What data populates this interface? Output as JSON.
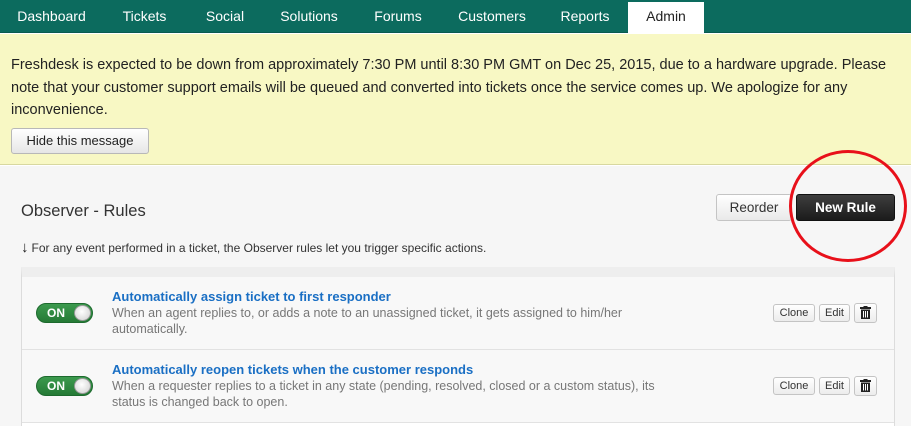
{
  "nav": {
    "tabs": [
      {
        "label": "Dashboard",
        "active": false
      },
      {
        "label": "Tickets",
        "active": false
      },
      {
        "label": "Social",
        "active": false
      },
      {
        "label": "Solutions",
        "active": false
      },
      {
        "label": "Forums",
        "active": false
      },
      {
        "label": "Customers",
        "active": false
      },
      {
        "label": "Reports",
        "active": false
      },
      {
        "label": "Admin",
        "active": true
      }
    ]
  },
  "banner": {
    "message": "Freshdesk is expected to be down from approximately 7:30 PM until 8:30 PM GMT on Dec 25, 2015, due to a hardware upgrade. Please note that your customer support emails will be queued and converted into tickets once the service comes up. We apologize for any inconvenience.",
    "hide_label": "Hide this message"
  },
  "page": {
    "title": "Observer - Rules",
    "reorder_label": "Reorder",
    "new_rule_label": "New Rule",
    "info_text": "For any event performed in a ticket, the Observer rules let you trigger specific actions."
  },
  "rules": [
    {
      "toggle": "ON",
      "title": "Automatically assign ticket to first responder",
      "description": "When an agent replies to, or adds a note to an unassigned ticket, it gets assigned to him/her automatically.",
      "clone_label": "Clone",
      "edit_label": "Edit"
    },
    {
      "toggle": "ON",
      "title": "Automatically reopen tickets when the customer responds",
      "description": "When a requester replies to a ticket in any state (pending, resolved, closed or a custom status), its status is changed back to open.",
      "clone_label": "Clone",
      "edit_label": "Edit"
    }
  ],
  "colors": {
    "nav_bg": "#0c6b5e",
    "banner_bg": "#f8f8c4",
    "link": "#1a6fc4",
    "toggle_on": "#2f8a42",
    "annotation": "#e8101a"
  }
}
